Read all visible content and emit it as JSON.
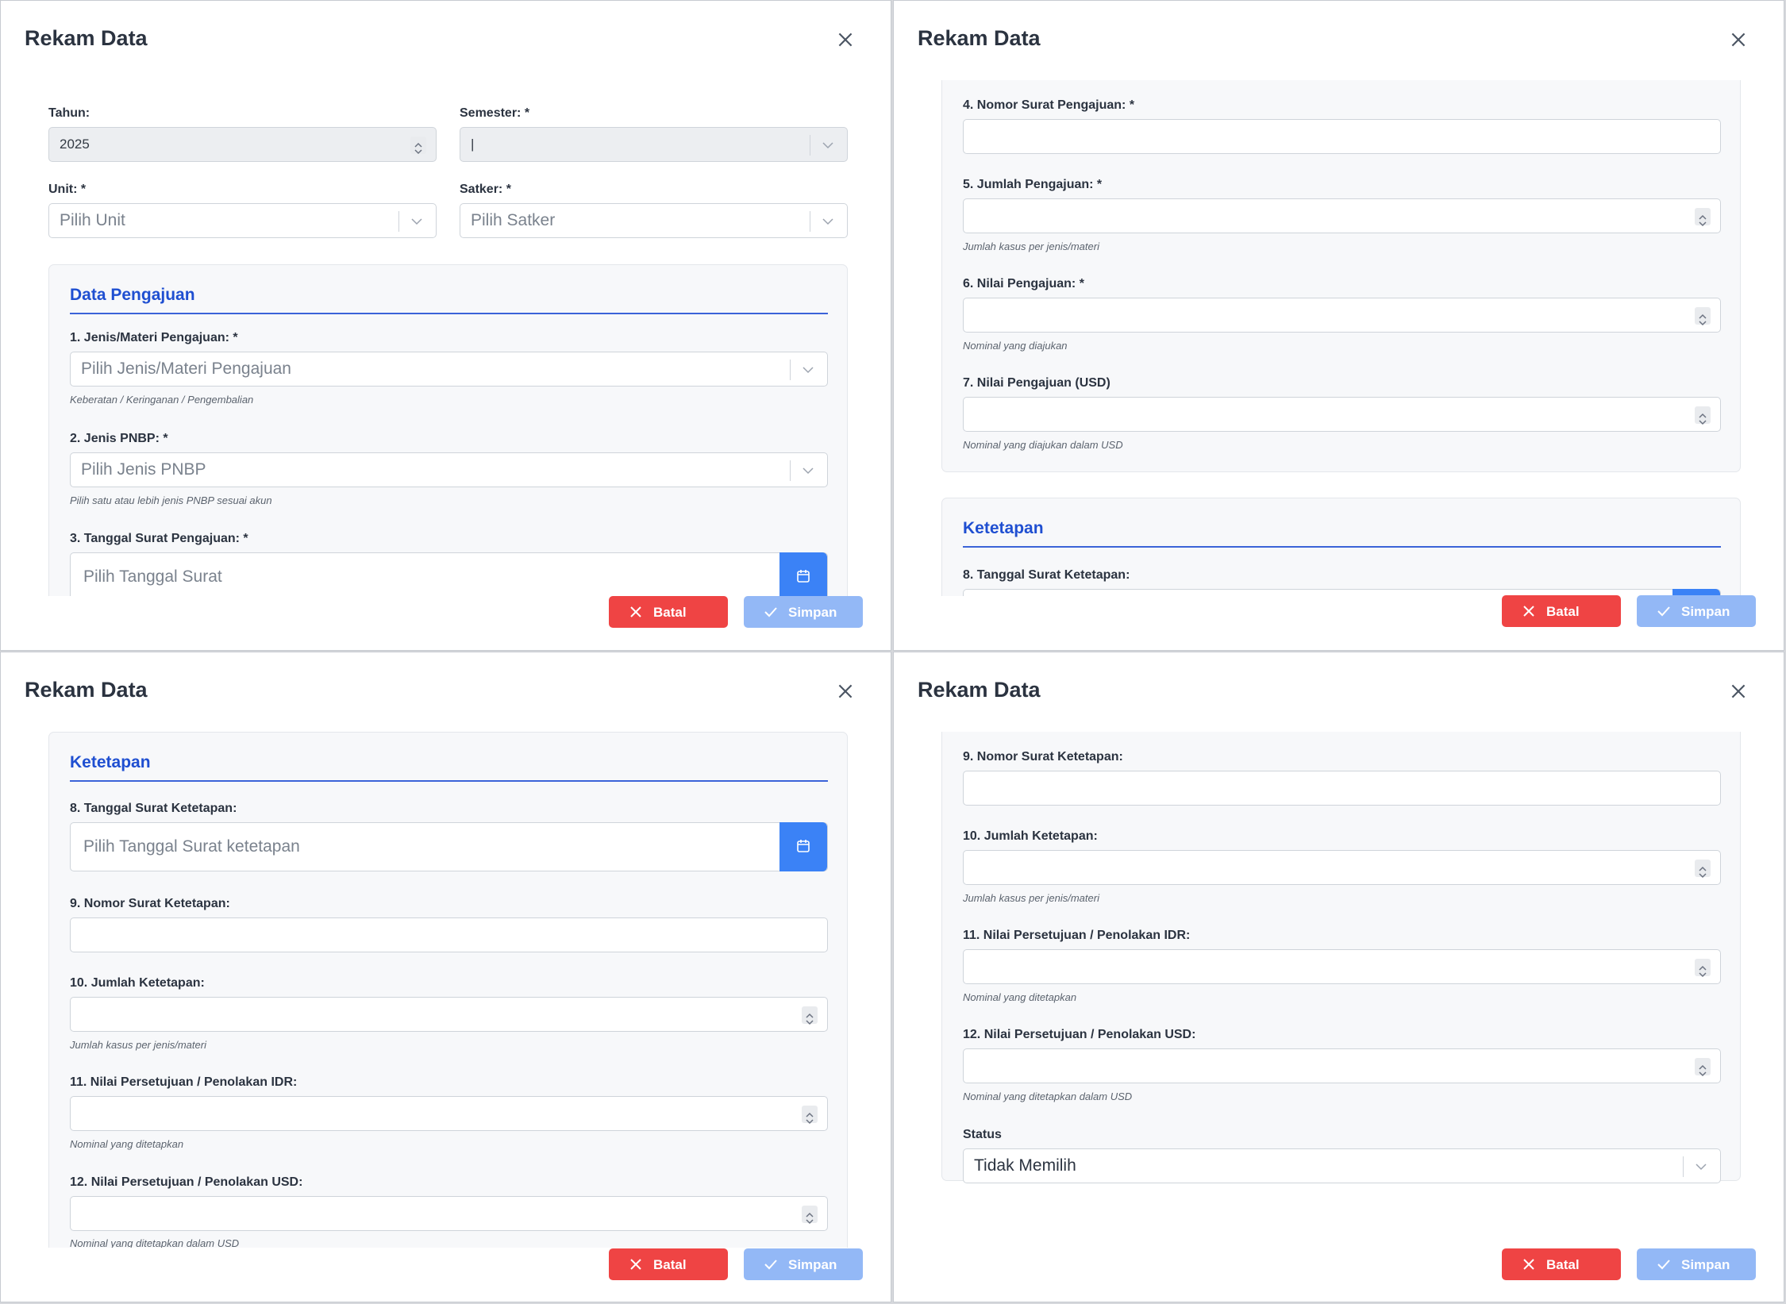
{
  "modal": {
    "title": "Rekam Data",
    "cancel_label": "Batal",
    "save_label": "Simpan"
  },
  "header_fields": {
    "tahun_label": "Tahun:",
    "tahun_value": "2025",
    "semester_label": "Semester: *",
    "semester_value": "|",
    "unit_label": "Unit: *",
    "unit_placeholder": "Pilih Unit",
    "satker_label": "Satker: *",
    "satker_placeholder": "Pilih Satker"
  },
  "pengajuan": {
    "section_title": "Data Pengajuan",
    "f1_label": "1. Jenis/Materi Pengajuan: *",
    "f1_placeholder": "Pilih Jenis/Materi Pengajuan",
    "f1_hint": "Keberatan / Keringanan / Pengembalian",
    "f2_label": "2. Jenis PNBP: *",
    "f2_placeholder": "Pilih Jenis PNBP",
    "f2_hint": "Pilih satu atau lebih jenis PNBP sesuai akun",
    "f3_label": "3. Tanggal Surat Pengajuan: *",
    "f3_placeholder": "Pilih Tanggal Surat",
    "f4_label": "4. Nomor Surat Pengajuan: *",
    "f5_label": "5. Jumlah Pengajuan: *",
    "f5_hint": "Jumlah kasus per jenis/materi",
    "f6_label": "6. Nilai Pengajuan: *",
    "f6_hint": "Nominal yang diajukan",
    "f7_label": "7. Nilai Pengajuan (USD)",
    "f7_hint": "Nominal yang diajukan dalam USD"
  },
  "ketetapan": {
    "section_title": "Ketetapan",
    "f8_label": "8. Tanggal Surat Ketetapan:",
    "f8_placeholder": "Pilih Tanggal Surat ketetapan",
    "f9_label": "9. Nomor Surat Ketetapan:",
    "f10_label": "10. Jumlah Ketetapan:",
    "f10_hint": "Jumlah kasus per jenis/materi",
    "f11_label": "11. Nilai Persetujuan / Penolakan IDR:",
    "f11_hint": "Nominal yang ditetapkan",
    "f12_label": "12. Nilai Persetujuan / Penolakan USD:",
    "f12_hint": "Nominal yang ditetapkan dalam USD",
    "status_label": "Status",
    "status_value": "Tidak Memilih"
  },
  "icons": {
    "close": "close-icon",
    "chevron": "chevron-down-icon",
    "spinner": "spinner-icon",
    "calendar": "calendar-icon",
    "cancel": "x-icon",
    "save": "check-icon"
  },
  "colors": {
    "primary": "#3b82f6",
    "danger": "#ef4444",
    "save_disabled": "#93b8f6",
    "section_title": "#1f4fd1"
  }
}
